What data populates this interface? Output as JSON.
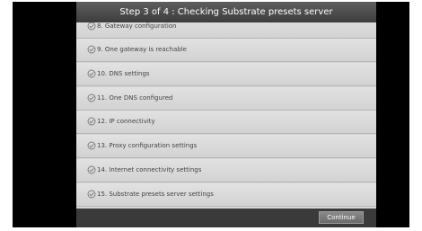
{
  "dialog": {
    "title": "Step 3 of 4 : Checking Substrate presets server"
  },
  "items": [
    {
      "label": "8. Gateway configuration",
      "status_icon": "check-icon"
    },
    {
      "label": "9. One gateway is reachable",
      "status_icon": "check-icon"
    },
    {
      "label": "10. DNS settings",
      "status_icon": "check-icon"
    },
    {
      "label": "11. One DNS configured",
      "status_icon": "check-icon"
    },
    {
      "label": "12. IP connectivity",
      "status_icon": "check-icon"
    },
    {
      "label": "13. Proxy configuration settings",
      "status_icon": "check-icon"
    },
    {
      "label": "14. Internet connectivity settings",
      "status_icon": "check-icon"
    },
    {
      "label": "15. Substrate presets server settings",
      "status_icon": "check-icon"
    }
  ],
  "footer": {
    "continue_label": "Continue"
  },
  "colors": {
    "title_bar": "#4a4a4a",
    "list_background": "#dcdcdc",
    "footer_bar": "#3a3a3a",
    "button": "#7a7a7a"
  }
}
